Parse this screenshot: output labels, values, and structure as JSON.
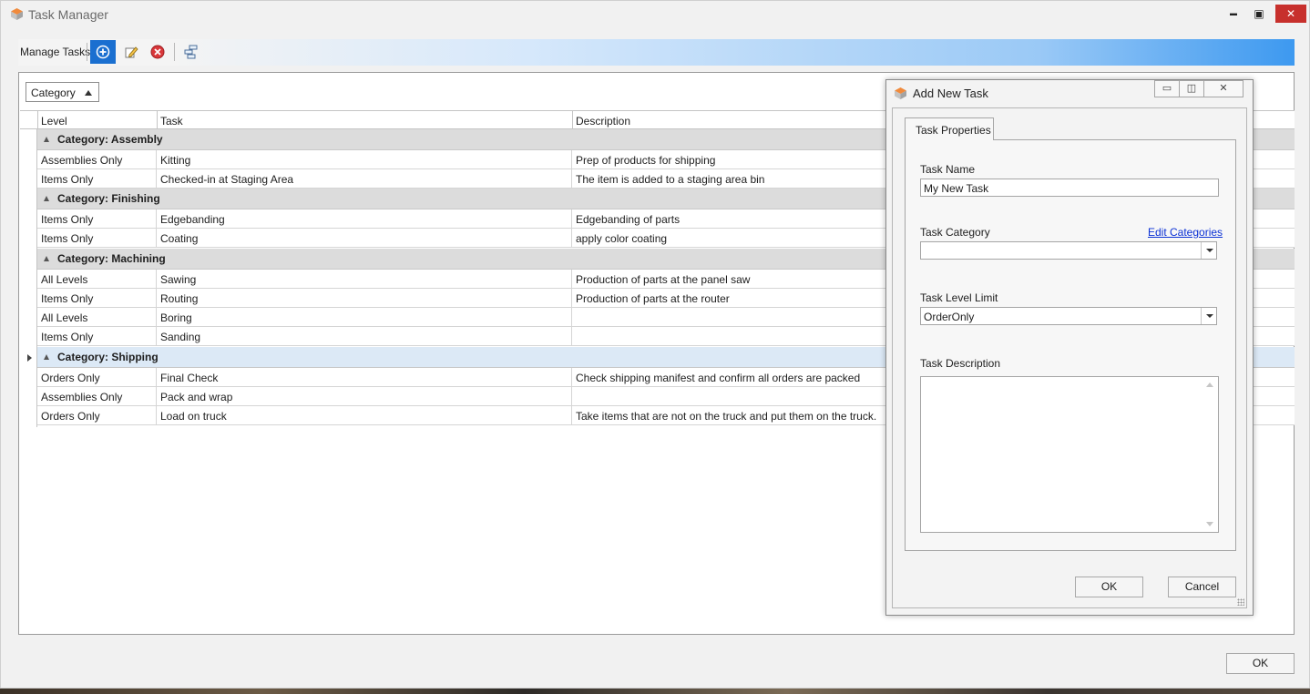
{
  "window": {
    "title": "Task Manager",
    "controls": {
      "minimize": "▬",
      "maximize": "▣",
      "close": "✕"
    }
  },
  "toolbar": {
    "label": "Manage Tasks",
    "buttons": [
      {
        "icon": "add-circle-icon"
      },
      {
        "icon": "edit-pencil-icon"
      },
      {
        "icon": "delete-circle-icon"
      },
      {
        "icon": "hierarchy-icon"
      }
    ]
  },
  "group_panel": {
    "group_by": "Category"
  },
  "grid": {
    "columns": [
      "Level",
      "Task",
      "Description"
    ],
    "groups": [
      {
        "label": "Category: Assembly",
        "rows": [
          {
            "level": "Assemblies Only",
            "task": "Kitting",
            "description": "Prep of products for shipping"
          },
          {
            "level": "Items Only",
            "task": "Checked-in at Staging Area",
            "description": "The item is added to a staging area bin"
          }
        ]
      },
      {
        "label": "Category: Finishing",
        "rows": [
          {
            "level": "Items Only",
            "task": "Edgebanding",
            "description": "Edgebanding of parts"
          },
          {
            "level": "Items Only",
            "task": "Coating",
            "description": "apply color coating"
          }
        ]
      },
      {
        "label": "Category: Machining",
        "rows": [
          {
            "level": "All Levels",
            "task": "Sawing",
            "description": "Production of parts at the panel saw"
          },
          {
            "level": "Items Only",
            "task": "Routing",
            "description": "Production of parts at the router"
          },
          {
            "level": "All Levels",
            "task": "Boring",
            "description": ""
          },
          {
            "level": "Items Only",
            "task": "Sanding",
            "description": ""
          }
        ]
      },
      {
        "label": "Category: Shipping",
        "rows": [
          {
            "level": "Orders Only",
            "task": "Final Check",
            "description": "Check shipping manifest and confirm all orders are packed"
          },
          {
            "level": "Assemblies Only",
            "task": "Pack and wrap",
            "description": ""
          },
          {
            "level": "Orders Only",
            "task": "Load on truck",
            "description": "Take items that are not on the truck and put them on the truck."
          }
        ]
      }
    ]
  },
  "footer": {
    "ok_label": "OK"
  },
  "dialog": {
    "title": "Add New Task",
    "controls": {
      "minimize": "▭",
      "restore": "◫",
      "close": "✕"
    },
    "tab_label": "Task Properties",
    "task_name": {
      "label": "Task Name",
      "value": "My New Task"
    },
    "task_category": {
      "label": "Task Category",
      "value": "",
      "edit_link": "Edit Categories"
    },
    "task_level_limit": {
      "label": "Task Level Limit",
      "value": "OrderOnly"
    },
    "task_description": {
      "label": "Task Description",
      "value": ""
    },
    "ok_label": "OK",
    "cancel_label": "Cancel"
  },
  "colors": {
    "toolbar_gradient_end": "#3d99f0",
    "active_button": "#1a6fd0",
    "group_row": "#dcdcdc",
    "focused_group_row": "#dce9f6",
    "close_button": "#c7302c",
    "link": "#0b31d5"
  }
}
